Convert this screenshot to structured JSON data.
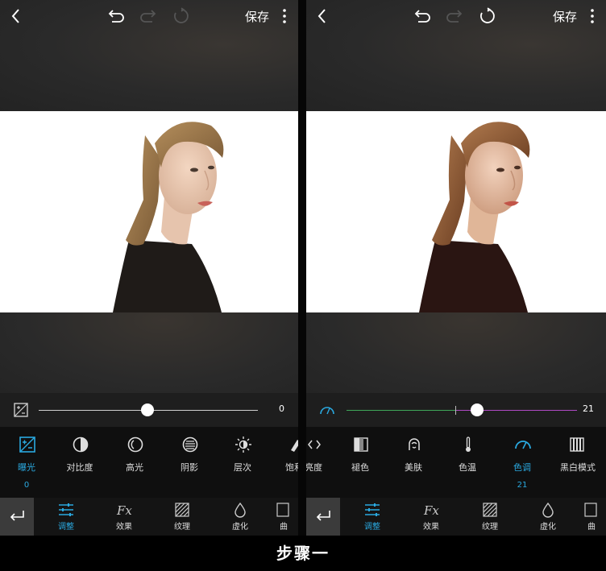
{
  "left": {
    "toolbar": {
      "save_label": "保存"
    },
    "slider": {
      "value_text": "0"
    },
    "tools": [
      {
        "label": "曝光",
        "value": "0"
      },
      {
        "label": "对比度"
      },
      {
        "label": "高光"
      },
      {
        "label": "阴影"
      },
      {
        "label": "层次"
      },
      {
        "label": "饱和"
      }
    ],
    "nav": [
      {
        "label": "调整"
      },
      {
        "label": "效果"
      },
      {
        "label": "纹理"
      },
      {
        "label": "虚化"
      },
      {
        "label": "曲"
      }
    ]
  },
  "right": {
    "toolbar": {
      "save_label": "保存"
    },
    "slider": {
      "value_text": "21"
    },
    "tools": [
      {
        "label": "亮度"
      },
      {
        "label": "褪色"
      },
      {
        "label": "美肤"
      },
      {
        "label": "色温"
      },
      {
        "label": "色调",
        "value": "21"
      },
      {
        "label": "黑白模式"
      }
    ],
    "nav": [
      {
        "label": "调整"
      },
      {
        "label": "效果"
      },
      {
        "label": "纹理"
      },
      {
        "label": "虚化"
      },
      {
        "label": "曲"
      }
    ]
  },
  "caption": "步骤一",
  "colors": {
    "accent": "#2aa9e0",
    "panel_bg": "#2a2a2a",
    "tools_bg": "#0f0f0f"
  },
  "icons": {
    "topbar": [
      "back-icon",
      "undo-icon",
      "redo-icon",
      "reset-icon",
      "more-icon"
    ],
    "left_tools": [
      "exposure-icon",
      "contrast-icon",
      "highlight-icon",
      "shadow-icon",
      "structure-icon",
      "saturation-icon"
    ],
    "right_tools": [
      "brightness-icon",
      "fade-icon",
      "skin-icon",
      "temperature-icon",
      "tint-icon",
      "bw-mode-icon"
    ],
    "nav": [
      "adjust-icon",
      "effect-icon",
      "texture-icon",
      "blur-icon",
      "curve-icon"
    ]
  }
}
